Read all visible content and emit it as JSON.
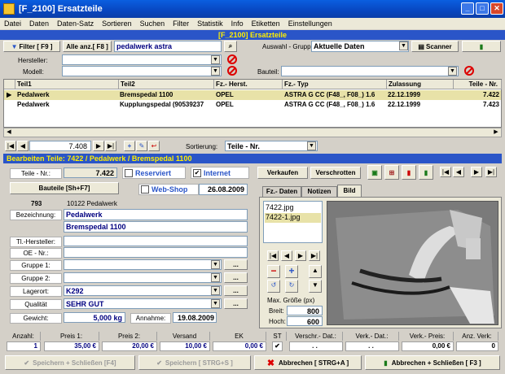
{
  "window": {
    "title": "[F_2100] Ersatzteile",
    "minimize": "_",
    "maximize": "□",
    "close": "✕"
  },
  "menu": [
    "Datei",
    "Daten",
    "Daten-Satz",
    "Sortieren",
    "Suchen",
    "Filter",
    "Statistik",
    "Info",
    "Etiketten",
    "Einstellungen"
  ],
  "form_title": "[F_2100] Ersatzteile",
  "toolbar": {
    "filter_label": "Filter [ F9 ]",
    "show_all_label": "Alle anz.[ F8 ]",
    "search_value": "pedalwerk astra",
    "group_label": "Auswahl - Gruppe:",
    "group_value": "Aktuelle Daten",
    "scanner_label": "Scanner"
  },
  "filters": {
    "manufacturer_label": "Hersteller:",
    "model_label": "Modell:",
    "component_label": "Bauteil:"
  },
  "grid": {
    "columns": [
      "Teil1",
      "Teil2",
      "Fz.- Herst.",
      "Fz.- Typ",
      "Zulassung",
      "Teile - Nr."
    ],
    "rows": [
      {
        "c1": "Pedalwerk",
        "c2": "Bremspedal 1100",
        "c3": "OPEL",
        "c4": "ASTRA G CC (F48_, F08_) 1.6",
        "c5": "22.12.1999",
        "c6": "7.422",
        "selected": true
      },
      {
        "c1": "Pedalwerk",
        "c2": "Kupplungspedal (90539237",
        "c3": "OPEL",
        "c4": "ASTRA G CC (F48_, F08_) 1.6",
        "c5": "22.12.1999",
        "c6": "7.423",
        "selected": false
      }
    ]
  },
  "nav": {
    "record": "7.408",
    "sort_label": "Sortierung:",
    "sort_value": "Teile - Nr."
  },
  "edit": {
    "title": "Bearbeiten Teile:   7422 / Pedalwerk / Bremspedal 1100",
    "part_no_label": "Teile - Nr.:",
    "part_no": "7.422",
    "reserved_label": "Reserviert",
    "internet_label": "Internet",
    "sell_label": "Verkaufen",
    "scrap_label": "Verschrotten",
    "component_btn": "Bauteile [Sh+F7]",
    "webshop_label": "Web-Shop",
    "webshop_date": "26.08.2009",
    "code": "793",
    "code_desc": "10122 Pedalwerk",
    "name_label": "Bezeichnung:",
    "name1": "Pedalwerk",
    "name2": "Bremspedal 1100",
    "tl_mfr_label": "Tl.-Hersteller:",
    "oe_label": "OE - Nr.:",
    "group1_label": "Gruppe 1:",
    "group2_label": "Gruppe 2:",
    "storage_label": "Lagerort:",
    "storage": "K292",
    "quality_label": "Qualität",
    "quality": "SEHR GUT",
    "weight_label": "Gewicht:",
    "weight": "5,000 kg",
    "accept_label": "Annahme:",
    "accept_date": "19.08.2009",
    "more": "..."
  },
  "tabs": [
    "Fz.- Daten",
    "Notizen",
    "Bild"
  ],
  "images": {
    "files": [
      "7422.jpg",
      "7422-1.jpg"
    ],
    "max_label": "Max. Größe (px)",
    "width_label": "Breit:",
    "width": "800",
    "height_label": "Hoch:",
    "height": "600"
  },
  "totals": {
    "headers": [
      "Anzahl:",
      "Preis 1:",
      "Preis 2:",
      "Versand",
      "EK",
      "ST",
      "Verschr.- Dat.:",
      "Verk.- Dat.:",
      "Verk.- Preis:",
      "Anz. Verk:"
    ],
    "values": [
      "1",
      "35,00 €",
      "20,00 €",
      "10,00 €",
      "0,00 €",
      "✔",
      ".  .",
      ".  .",
      "0,00 €",
      "0"
    ]
  },
  "bottom": {
    "save_close": "Speichern + Schließen [F4]",
    "save": "Speichern [ STRG+S ]",
    "cancel": "Abbrechen [ STRG+A ]",
    "cancel_close": "Abbrechen + Schließen [ F3 ]"
  },
  "colors": {
    "accent": "#2a55c8",
    "title_yellow": "#ffef00",
    "selected_row": "#e8e2a8"
  }
}
